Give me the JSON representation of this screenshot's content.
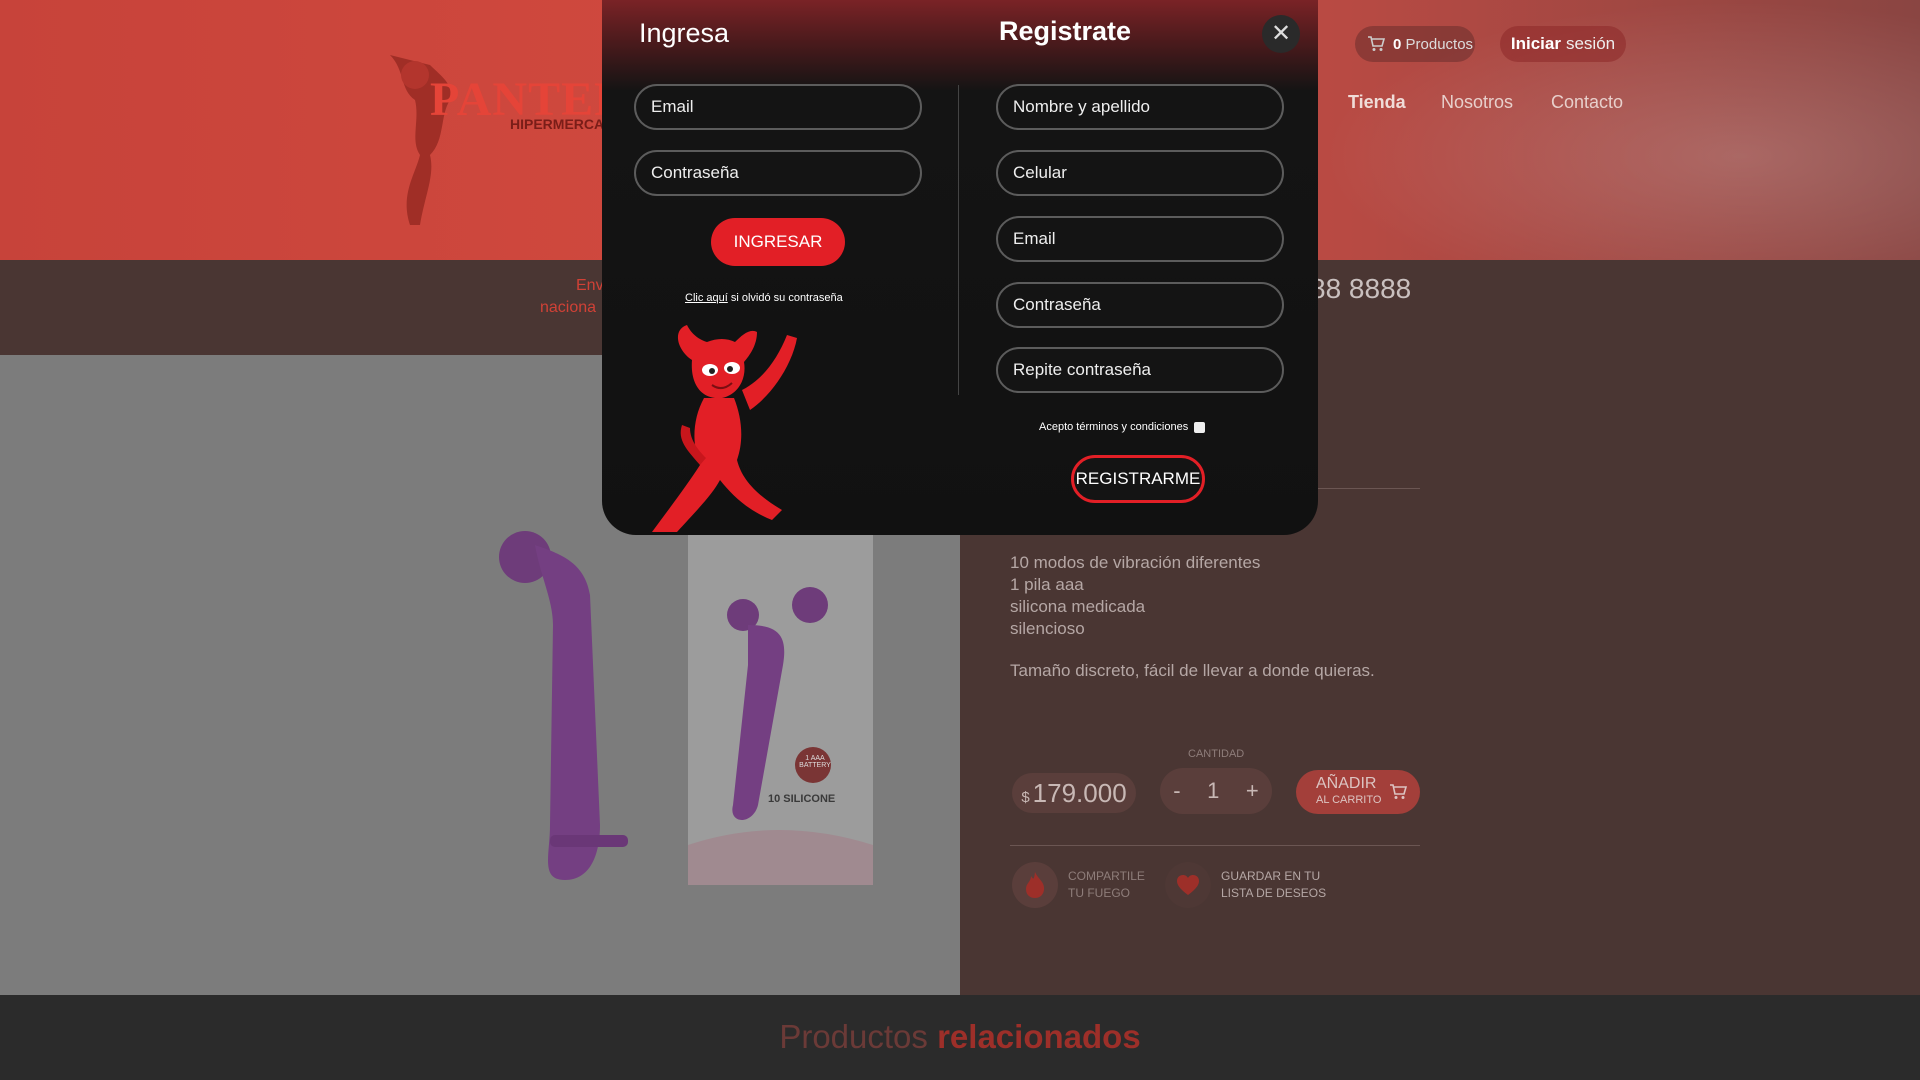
{
  "colors": {
    "accent": "#e21f26",
    "modal_bg": "#111111",
    "field_border": "#5c5c5c"
  },
  "header": {
    "logo_text": "PANTERA",
    "logo_subtitle": "HIPERMERCADO",
    "cart_count": "0",
    "cart_label": "Productos",
    "login_bold": "Iniciar",
    "login_rest": "sesión",
    "nav": [
      "Tienda",
      "Nosotros",
      "Contacto"
    ]
  },
  "strip": {
    "left_line1": "Env",
    "left_line2": "naciona",
    "phone": "88 8888"
  },
  "product": {
    "features": [
      "10 modos de vibración diferentes",
      "1 pila aaa",
      "silicona medicada",
      "silencioso"
    ],
    "description": "Tamaño discreto, fácil de llevar a donde quieras.",
    "price_symbol": "$",
    "price": "179.000",
    "qty_label": "CANTIDAD",
    "qty_minus": "-",
    "qty_value": "1",
    "qty_plus": "+",
    "add_label": "AÑADIR",
    "add_sub": "AL CARRITO",
    "share_line1": "COMPARTILE",
    "share_line2": "TU FUEGO",
    "wish_line1": "GUARDAR EN TU",
    "wish_line2": "LISTA DE DESEOS",
    "box_badge": "1 AAA BATTERY",
    "box_text": "10 SILICONE"
  },
  "related": {
    "light": "Productos",
    "bold": "relacionados"
  },
  "modal": {
    "login_title": "Ingresa",
    "register_title": "Registrate",
    "close_symbol": "✕",
    "login_fields": [
      "Email",
      "Contraseña"
    ],
    "login_button": "INGRESAR",
    "forgot_link": "Clic aquí",
    "forgot_rest": " si olvidó su contraseña",
    "register_fields": [
      "Nombre y apellido",
      "Celular",
      "Email",
      "Contraseña",
      "Repite contraseña"
    ],
    "terms_label": "Acepto términos y condiciones",
    "register_button": "REGISTRARME"
  }
}
